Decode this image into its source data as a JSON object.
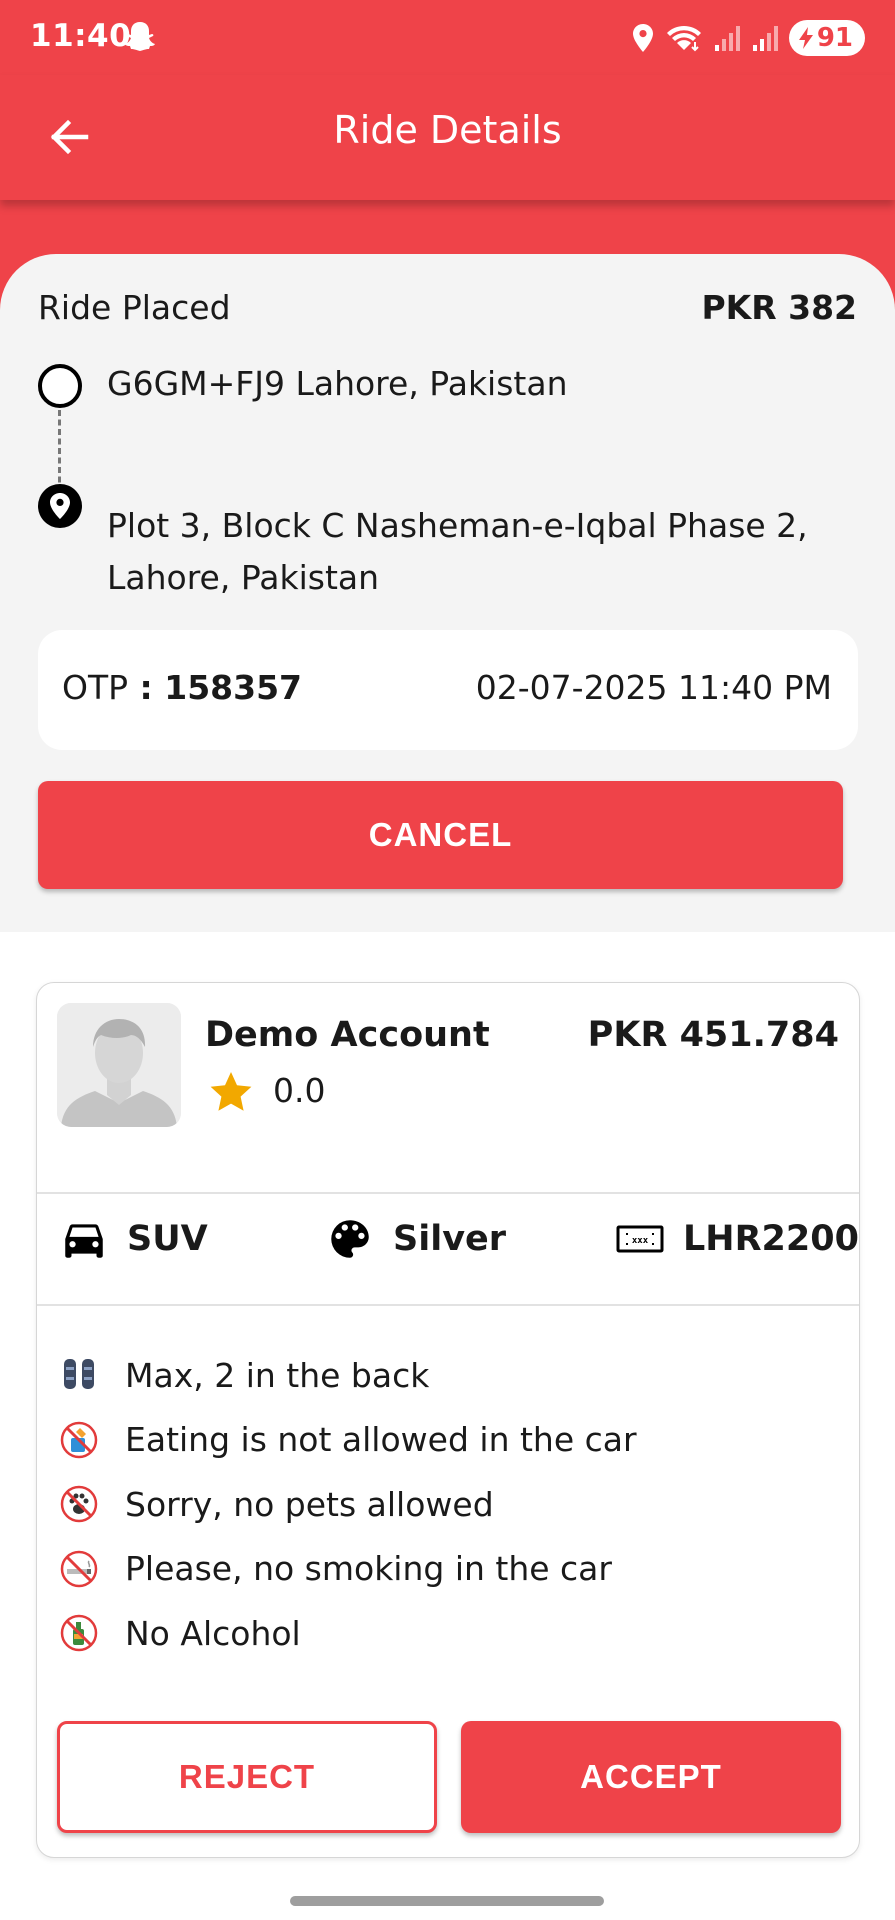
{
  "status_bar": {
    "time": "11:40",
    "battery": "91",
    "icons": [
      "snapchat-icon",
      "location-icon",
      "wifi-icon",
      "signal-icon",
      "signal-icon",
      "battery-charging-icon"
    ]
  },
  "app_bar": {
    "title": "Ride Details",
    "back_icon": "arrow-back-icon"
  },
  "ride": {
    "status": "Ride Placed",
    "fare": "PKR 382",
    "pickup": "G6GM+FJ9 Lahore, Pakistan",
    "dropoff": "Plot 3, Block C Nasheman-e-Iqbal Phase 2, Lahore, Pakistan",
    "otp_label": "OTP",
    "otp_separator": " : ",
    "otp_value": "158357",
    "datetime": "02-07-2025 11:40 PM",
    "cancel_label": "CANCEL"
  },
  "driver": {
    "name": "Demo Account",
    "rating": "0.0",
    "fare": "PKR 451.784",
    "vehicle_type": "SUV",
    "vehicle_color": "Silver",
    "plate": "LHR2200",
    "preferences": [
      {
        "icon": "seats-icon",
        "label": "Max, 2 in the back"
      },
      {
        "icon": "no-eating-icon",
        "label": "Eating is not allowed in the car"
      },
      {
        "icon": "no-pets-icon",
        "label": "Sorry, no pets allowed"
      },
      {
        "icon": "no-smoking-icon",
        "label": "Please, no smoking in the car"
      },
      {
        "icon": "no-alcohol-icon",
        "label": "No Alcohol"
      }
    ],
    "reject_label": "REJECT",
    "accept_label": "ACCEPT"
  },
  "colors": {
    "primary": "#ef4349",
    "star": "#f2a800",
    "panel_background": "#f4f4f4"
  }
}
